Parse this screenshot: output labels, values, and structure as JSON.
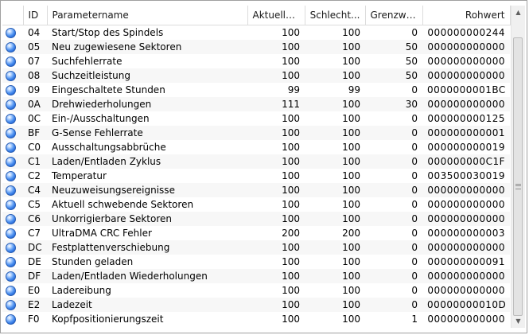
{
  "columns": {
    "id": "ID",
    "name": "Parametername",
    "current": "Aktueller...",
    "worst": "Schlecht...",
    "threshold": "Grenzwert",
    "raw": "Rohwert"
  },
  "status_icon": "blue-status-dot-icon",
  "accent_color": "#2f7be0",
  "rows": [
    {
      "id": "04",
      "name": "Start/Stop des Spindels",
      "current": "100",
      "worst": "100",
      "threshold": "0",
      "raw": "000000000244"
    },
    {
      "id": "05",
      "name": "Neu zugewiesene Sektoren",
      "current": "100",
      "worst": "100",
      "threshold": "50",
      "raw": "000000000000"
    },
    {
      "id": "07",
      "name": "Suchfehlerrate",
      "current": "100",
      "worst": "100",
      "threshold": "50",
      "raw": "000000000000"
    },
    {
      "id": "08",
      "name": "Suchzeitleistung",
      "current": "100",
      "worst": "100",
      "threshold": "50",
      "raw": "000000000000"
    },
    {
      "id": "09",
      "name": "Eingeschaltete Stunden",
      "current": "99",
      "worst": "99",
      "threshold": "0",
      "raw": "0000000001BC"
    },
    {
      "id": "0A",
      "name": "Drehwiederholungen",
      "current": "111",
      "worst": "100",
      "threshold": "30",
      "raw": "000000000000"
    },
    {
      "id": "0C",
      "name": "Ein-/Ausschaltungen",
      "current": "100",
      "worst": "100",
      "threshold": "0",
      "raw": "000000000125"
    },
    {
      "id": "BF",
      "name": "G-Sense Fehlerrate",
      "current": "100",
      "worst": "100",
      "threshold": "0",
      "raw": "000000000001"
    },
    {
      "id": "C0",
      "name": "Ausschaltungsabbrüche",
      "current": "100",
      "worst": "100",
      "threshold": "0",
      "raw": "000000000019"
    },
    {
      "id": "C1",
      "name": "Laden/Entladen Zyklus",
      "current": "100",
      "worst": "100",
      "threshold": "0",
      "raw": "000000000C1F"
    },
    {
      "id": "C2",
      "name": "Temperatur",
      "current": "100",
      "worst": "100",
      "threshold": "0",
      "raw": "003500030019"
    },
    {
      "id": "C4",
      "name": "Neuzuweisungsereignisse",
      "current": "100",
      "worst": "100",
      "threshold": "0",
      "raw": "000000000000"
    },
    {
      "id": "C5",
      "name": "Aktuell schwebende Sektoren",
      "current": "100",
      "worst": "100",
      "threshold": "0",
      "raw": "000000000000"
    },
    {
      "id": "C6",
      "name": "Unkorrigierbare Sektoren",
      "current": "100",
      "worst": "100",
      "threshold": "0",
      "raw": "000000000000"
    },
    {
      "id": "C7",
      "name": "UltraDMA CRC Fehler",
      "current": "200",
      "worst": "200",
      "threshold": "0",
      "raw": "000000000003"
    },
    {
      "id": "DC",
      "name": "Festplattenverschiebung",
      "current": "100",
      "worst": "100",
      "threshold": "0",
      "raw": "000000000000"
    },
    {
      "id": "DE",
      "name": "Stunden geladen",
      "current": "100",
      "worst": "100",
      "threshold": "0",
      "raw": "000000000091"
    },
    {
      "id": "DF",
      "name": "Laden/Entladen Wiederholungen",
      "current": "100",
      "worst": "100",
      "threshold": "0",
      "raw": "000000000000"
    },
    {
      "id": "E0",
      "name": "Ladereibung",
      "current": "100",
      "worst": "100",
      "threshold": "0",
      "raw": "000000000000"
    },
    {
      "id": "E2",
      "name": "Ladezeit",
      "current": "100",
      "worst": "100",
      "threshold": "0",
      "raw": "00000000010D"
    },
    {
      "id": "F0",
      "name": "Kopfpositionierungszeit",
      "current": "100",
      "worst": "100",
      "threshold": "1",
      "raw": "000000000000"
    }
  ]
}
